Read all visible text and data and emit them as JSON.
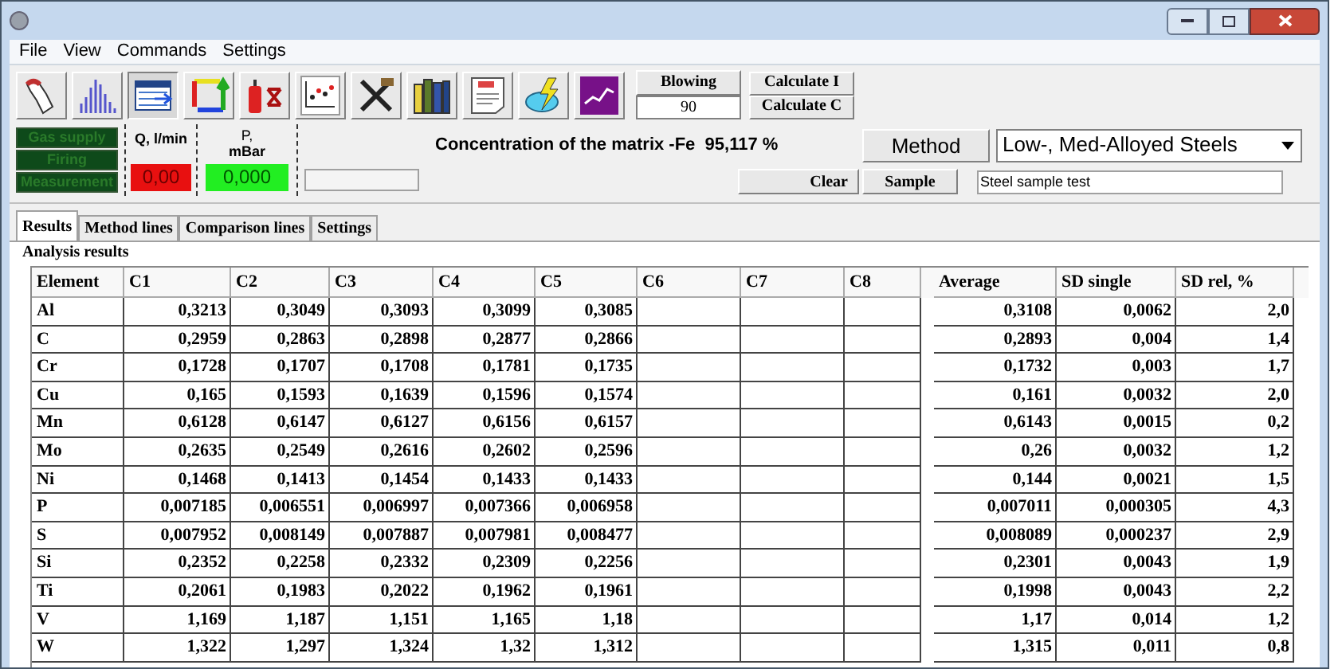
{
  "menu": [
    "File",
    "View",
    "Commands",
    "Settings"
  ],
  "toolbar": [
    {
      "kind": "hand",
      "selected": false
    },
    {
      "kind": "spectrum",
      "selected": false
    },
    {
      "kind": "table",
      "selected": true
    },
    {
      "kind": "arrows",
      "selected": false
    },
    {
      "kind": "gas",
      "selected": false
    },
    {
      "kind": "chart",
      "selected": false
    },
    {
      "kind": "tools",
      "selected": false
    },
    {
      "kind": "books",
      "selected": false
    },
    {
      "kind": "document",
      "selected": false
    },
    {
      "kind": "lightning",
      "selected": false
    },
    {
      "kind": "graph",
      "selected": false
    }
  ],
  "blowing": {
    "label": "Blowing",
    "value": "90"
  },
  "calc_buttons": [
    "Calculate I",
    "Calculate C"
  ],
  "indicators": [
    "Gas supply",
    "Firing",
    "Measurement"
  ],
  "flow": {
    "label": "Q, l/min",
    "value": "0,00"
  },
  "pressure": {
    "label": "P,",
    "unit": "mBar",
    "value": "0,000"
  },
  "progress": {
    "level": 0
  },
  "concentration": "Concentration of the matrix -Fe  95,117 %",
  "method_button": "Method",
  "method_select": "Low-, Med-Alloyed Steels",
  "clear_button": "Clear",
  "sample_button": "Sample",
  "sample_field": "Steel sample test",
  "tabs": [
    {
      "label": "Results",
      "selected": true
    },
    {
      "label": "Method lines",
      "selected": false
    },
    {
      "label": "Comparison lines",
      "selected": false
    },
    {
      "label": "Settings",
      "selected": false
    }
  ],
  "group_title": "Analysis results",
  "table": {
    "columns": [
      "Element",
      "C1",
      "C2",
      "C3",
      "C4",
      "C5",
      "C6",
      "C7",
      "C8"
    ],
    "stat_columns": [
      "Average",
      "SD single",
      "SD rel, %"
    ],
    "rows": [
      {
        "element": "Al",
        "values": [
          "0,3213",
          "0,3049",
          "0,3093",
          "0,3099",
          "0,3085"
        ],
        "stats": [
          "0,3108",
          "0,0062",
          "2,0"
        ]
      },
      {
        "element": "C",
        "values": [
          "0,2959",
          "0,2863",
          "0,2898",
          "0,2877",
          "0,2866"
        ],
        "stats": [
          "0,2893",
          "0,004",
          "1,4"
        ]
      },
      {
        "element": "Cr",
        "values": [
          "0,1728",
          "0,1707",
          "0,1708",
          "0,1781",
          "0,1735"
        ],
        "stats": [
          "0,1732",
          "0,003",
          "1,7"
        ]
      },
      {
        "element": "Cu",
        "values": [
          "0,165",
          "0,1593",
          "0,1639",
          "0,1596",
          "0,1574"
        ],
        "stats": [
          "0,161",
          "0,0032",
          "2,0"
        ]
      },
      {
        "element": "Mn",
        "values": [
          "0,6128",
          "0,6147",
          "0,6127",
          "0,6156",
          "0,6157"
        ],
        "stats": [
          "0,6143",
          "0,0015",
          "0,2"
        ]
      },
      {
        "element": "Mo",
        "values": [
          "0,2635",
          "0,2549",
          "0,2616",
          "0,2602",
          "0,2596"
        ],
        "stats": [
          "0,26",
          "0,0032",
          "1,2"
        ]
      },
      {
        "element": "Ni",
        "values": [
          "0,1468",
          "0,1413",
          "0,1454",
          "0,1433",
          "0,1433"
        ],
        "stats": [
          "0,144",
          "0,0021",
          "1,5"
        ]
      },
      {
        "element": "P",
        "values": [
          "0,007185",
          "0,006551",
          "0,006997",
          "0,007366",
          "0,006958"
        ],
        "stats": [
          "0,007011",
          "0,000305",
          "4,3"
        ]
      },
      {
        "element": "S",
        "values": [
          "0,007952",
          "0,008149",
          "0,007887",
          "0,007981",
          "0,008477"
        ],
        "stats": [
          "0,008089",
          "0,000237",
          "2,9"
        ]
      },
      {
        "element": "Si",
        "values": [
          "0,2352",
          "0,2258",
          "0,2332",
          "0,2309",
          "0,2256"
        ],
        "stats": [
          "0,2301",
          "0,0043",
          "1,9"
        ]
      },
      {
        "element": "Ti",
        "values": [
          "0,2061",
          "0,1983",
          "0,2022",
          "0,1962",
          "0,1961"
        ],
        "stats": [
          "0,1998",
          "0,0043",
          "2,2"
        ]
      },
      {
        "element": "V",
        "values": [
          "1,169",
          "1,187",
          "1,151",
          "1,165",
          "1,18"
        ],
        "stats": [
          "1,17",
          "0,014",
          "1,2"
        ]
      },
      {
        "element": "W",
        "values": [
          "1,322",
          "1,297",
          "1,324",
          "1,32",
          "1,312"
        ],
        "stats": [
          "1,315",
          "0,011",
          "0,8"
        ]
      }
    ]
  }
}
